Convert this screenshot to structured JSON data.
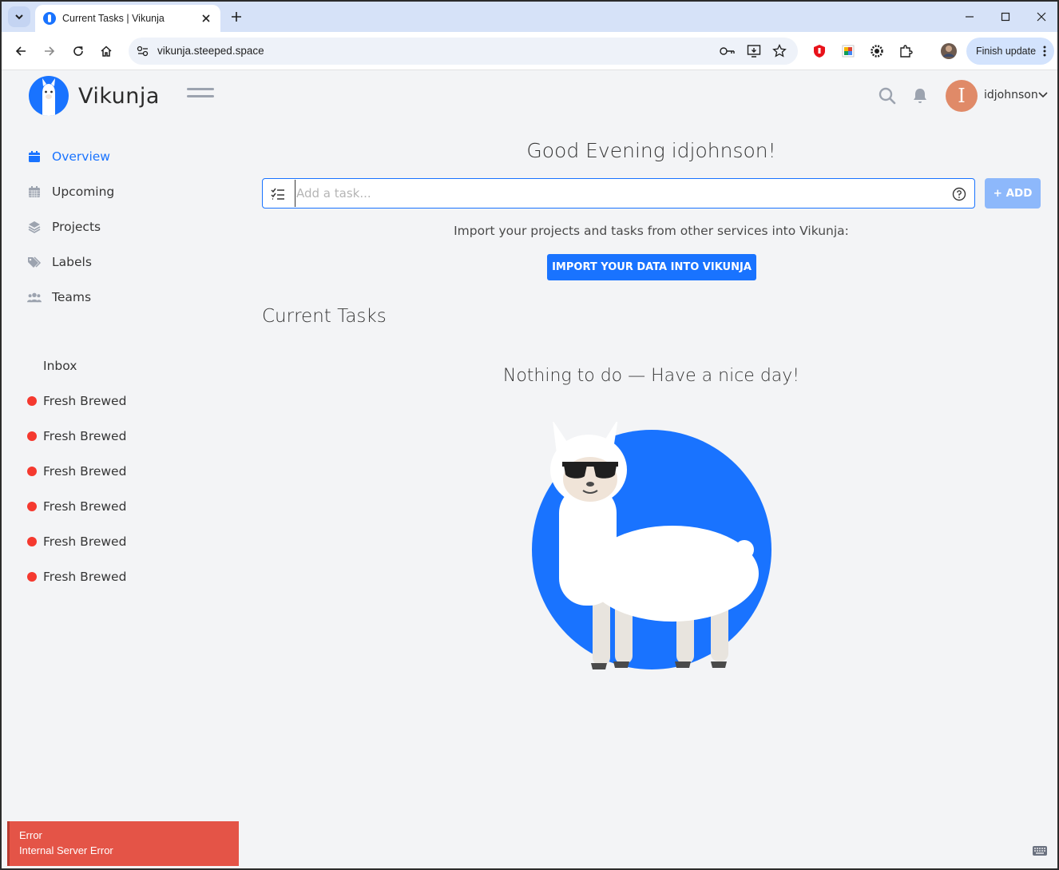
{
  "browser": {
    "tab_title": "Current Tasks | Vikunja",
    "url": "vikunja.steeped.space",
    "finish_update_label": "Finish update"
  },
  "app": {
    "logo_text": "Vikunja",
    "username": "idjohnson",
    "avatar_letter": "I",
    "brand_color": "#1973ff"
  },
  "nav": {
    "items": [
      {
        "label": "Overview",
        "icon": "calendar-icon",
        "active": true
      },
      {
        "label": "Upcoming",
        "icon": "calendar-grid-icon",
        "active": false
      },
      {
        "label": "Projects",
        "icon": "layers-icon",
        "active": false
      },
      {
        "label": "Labels",
        "icon": "tags-icon",
        "active": false
      },
      {
        "label": "Teams",
        "icon": "users-icon",
        "active": false
      }
    ]
  },
  "projects": {
    "items": [
      {
        "label": "Inbox",
        "dot": false
      },
      {
        "label": "Fresh Brewed",
        "dot": true
      },
      {
        "label": "Fresh Brewed",
        "dot": true
      },
      {
        "label": "Fresh Brewed",
        "dot": true
      },
      {
        "label": "Fresh Brewed",
        "dot": true
      },
      {
        "label": "Fresh Brewed",
        "dot": true
      },
      {
        "label": "Fresh Brewed",
        "dot": true
      }
    ],
    "dot_color": "#f5392f"
  },
  "main": {
    "greeting": "Good Evening idjohnson!",
    "add_task_placeholder": "Add a task...",
    "add_button_label": "+ ADD",
    "import_text": "Import your projects and tasks from other services into Vikunja:",
    "import_button_label": "IMPORT YOUR DATA INTO VIKUNJA",
    "section_title": "Current Tasks",
    "empty_message": "Nothing to do — Have a nice day!"
  },
  "toast": {
    "title": "Error",
    "message": "Internal Server Error",
    "color": "#e45447"
  }
}
